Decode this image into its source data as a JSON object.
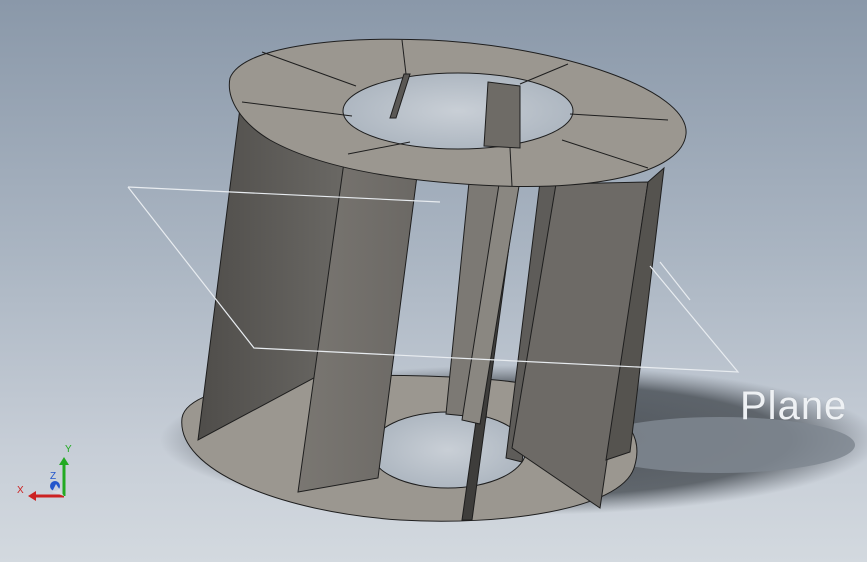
{
  "viewport": {
    "plane_label": "Plane",
    "background_top": "#8a98a9",
    "background_bottom": "#d3d9df"
  },
  "model": {
    "part_color": "#9b9790",
    "shaded_face_color": "#5f5d5a",
    "edge_color": "#1e1e1e"
  },
  "triad": {
    "x_label": "X",
    "y_label": "Y",
    "z_label": "Z",
    "x_color": "#cc2222",
    "y_color": "#22aa22",
    "z_color": "#2255cc"
  }
}
